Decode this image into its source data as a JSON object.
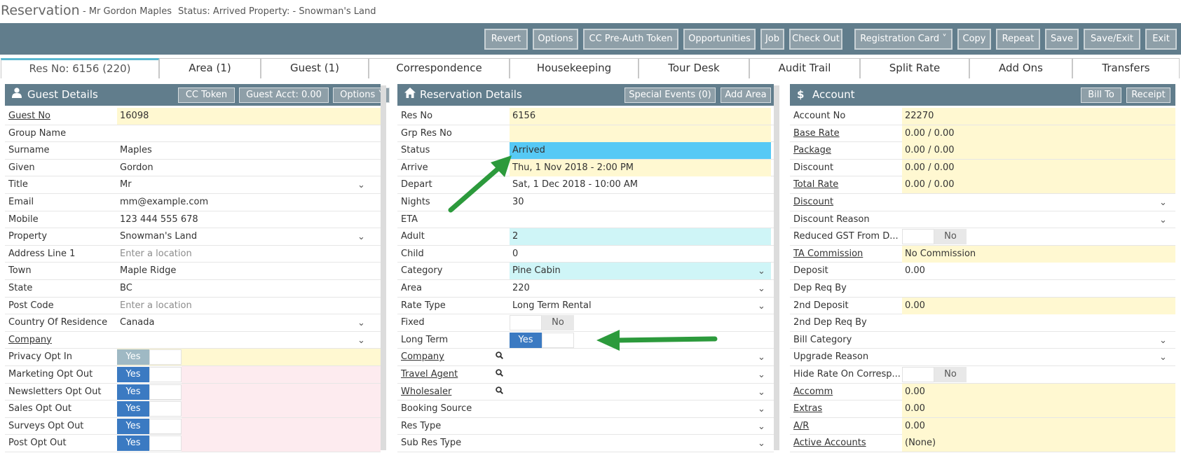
{
  "header": {
    "title": "Reservation",
    "subtitle": "-  Mr Gordon Maples",
    "status_line": "Status: Arrived Property: - Snowman's Land"
  },
  "toolbar": {
    "buttons": [
      "Revert",
      "Options",
      "CC Pre-Auth Token",
      "Opportunities",
      "Job",
      "Check Out",
      "Registration Card ˅",
      "Copy",
      "Repeat",
      "Save",
      "Save/Exit",
      "Exit"
    ]
  },
  "tabs": [
    "Res No: 6156 (220)",
    "Area (1)",
    "Guest (1)",
    "Correspondence",
    "Housekeeping",
    "Tour Desk",
    "Audit Trail",
    "Split Rate",
    "Add Ons",
    "Transfers"
  ],
  "guest_details": {
    "title": "Guest Details",
    "buttons": [
      "CC Token",
      "Guest Acct: 0.00",
      "Options ˅"
    ],
    "rows": [
      {
        "label": "Guest No",
        "value": "16098"
      },
      {
        "label": "Group Name",
        "value": ""
      },
      {
        "label": "Surname",
        "value": "Maples"
      },
      {
        "label": "Given",
        "value": "Gordon"
      },
      {
        "label": "Title",
        "value": "Mr"
      },
      {
        "label": "Email",
        "value": "mm@example.com"
      },
      {
        "label": "Mobile",
        "value": "123 444 555 678"
      },
      {
        "label": "Property",
        "value": "Snowman's Land"
      },
      {
        "label": "Address Line 1",
        "value": "Enter a location"
      },
      {
        "label": "Town",
        "value": "Maple Ridge"
      },
      {
        "label": "State",
        "value": "BC"
      },
      {
        "label": "Post Code",
        "value": "Enter a location"
      },
      {
        "label": "Country Of Residence",
        "value": "Canada"
      },
      {
        "label": "Company",
        "value": ""
      },
      {
        "label": "Privacy Opt In",
        "value": "Yes"
      },
      {
        "label": "Marketing Opt Out",
        "value": "Yes"
      },
      {
        "label": "Newsletters Opt Out",
        "value": "Yes"
      },
      {
        "label": "Sales Opt Out",
        "value": "Yes"
      },
      {
        "label": "Surveys Opt Out",
        "value": "Yes"
      },
      {
        "label": "Post Opt Out",
        "value": "Yes"
      }
    ]
  },
  "reservation_details": {
    "title": "Reservation Details",
    "buttons": [
      "Special Events (0)",
      "Add Area"
    ],
    "rows": [
      {
        "label": "Res No",
        "value": "6156"
      },
      {
        "label": "Grp Res No",
        "value": ""
      },
      {
        "label": "Status",
        "value": "Arrived"
      },
      {
        "label": "Arrive",
        "value": "Thu, 1 Nov 2018 - 2:00 PM"
      },
      {
        "label": "Depart",
        "value": "Sat, 1 Dec 2018 - 10:00 AM"
      },
      {
        "label": "Nights",
        "value": "30"
      },
      {
        "label": "ETA",
        "value": ""
      },
      {
        "label": "Adult",
        "value": "2"
      },
      {
        "label": "Child",
        "value": "0"
      },
      {
        "label": "Category",
        "value": "Pine Cabin"
      },
      {
        "label": "Area",
        "value": "220"
      },
      {
        "label": "Rate Type",
        "value": "Long Term Rental"
      },
      {
        "label": "Fixed",
        "value": "No"
      },
      {
        "label": "Long Term",
        "value": "Yes"
      },
      {
        "label": "Company",
        "value": ""
      },
      {
        "label": "Travel Agent",
        "value": ""
      },
      {
        "label": "Wholesaler",
        "value": ""
      },
      {
        "label": "Booking Source",
        "value": ""
      },
      {
        "label": "Res Type",
        "value": ""
      },
      {
        "label": "Sub Res Type",
        "value": ""
      }
    ]
  },
  "account": {
    "title": "Account",
    "buttons": [
      "Bill To",
      "Receipt"
    ],
    "rows": [
      {
        "label": "Account No",
        "value": "22270"
      },
      {
        "label": "Base Rate",
        "value": "0.00 / 0.00"
      },
      {
        "label": "Package",
        "value": "0.00 / 0.00"
      },
      {
        "label": "Discount",
        "value": "0.00 / 0.00"
      },
      {
        "label": "Total Rate",
        "value": "0.00 / 0.00"
      },
      {
        "label": "Discount",
        "value": ""
      },
      {
        "label": "Discount Reason",
        "value": ""
      },
      {
        "label": "Reduced GST From D...",
        "value": "No"
      },
      {
        "label": "TA Commission",
        "value": "No Commission"
      },
      {
        "label": "Deposit",
        "value": "0.00"
      },
      {
        "label": "Dep Req By",
        "value": ""
      },
      {
        "label": "2nd Deposit",
        "value": "0.00"
      },
      {
        "label": "2nd Dep Req By",
        "value": ""
      },
      {
        "label": "Bill Category",
        "value": ""
      },
      {
        "label": "Upgrade Reason",
        "value": ""
      },
      {
        "label": "Hide Rate On Corresp...",
        "value": "No"
      },
      {
        "label": "Accomm",
        "value": "0.00"
      },
      {
        "label": "Extras",
        "value": "0.00"
      },
      {
        "label": "A/R",
        "value": "0.00"
      },
      {
        "label": "Active Accounts",
        "value": "(None)"
      }
    ]
  },
  "icons": {
    "guest": "user-icon",
    "reservation": "home-icon",
    "account": "dollar-icon",
    "lookup": "magnifier-icon",
    "dropdown": "chevron-down-icon"
  },
  "colors": {
    "header_bar": "#617d8c",
    "button": "#8e9fa8",
    "status_arrived": "#56c9f5",
    "toggle_on": "#3b7ac2",
    "arrow": "#2c9a3c",
    "required_field": "#fff8d1"
  }
}
